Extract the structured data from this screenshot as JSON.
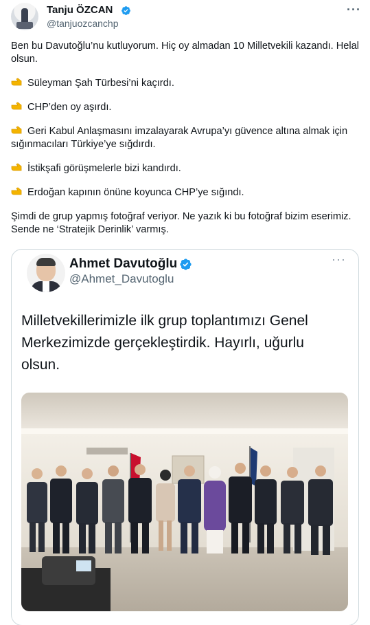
{
  "author": {
    "name": "Tanju ÖZCAN",
    "handle": "@tanjuozcanchp",
    "verified_color": "#1d9bf0"
  },
  "tweet": {
    "intro": "Ben bu Davutoğlu’nu kutluyorum. Hiç oy almadan 10 Milletvekili kazandı. Helal olsun.",
    "points": [
      "Süleyman Şah Türbesi’ni kaçırdı.",
      "CHP’den oy aşırdı.",
      "Geri Kabul Anlaşmasını imzalayarak Avrupa’yı güvence altına almak için sığınmacıları Türkiye’ye sığdırdı.",
      "İstikşafi görüşmelerle bizi kandırdı.",
      "Erdoğan kapının önüne koyunca CHP’ye sığındı."
    ],
    "point_icon": "pointing-hand-icon",
    "outro": "Şimdi de grup yapmış fotoğraf veriyor. Ne yazık ki bu fotoğraf bizim eserimiz. Sende ne ‘Stratejik Derinlik’ varmış."
  },
  "quoted": {
    "name": "Ahmet Davutoğlu",
    "handle": "@Ahmet_Davutoglu",
    "text": "Milletvekillerimizle ilk grup toplantımızı Genel Merkezimizde gerçekleştirdik. Hayırlı, uğurlu olsun."
  }
}
